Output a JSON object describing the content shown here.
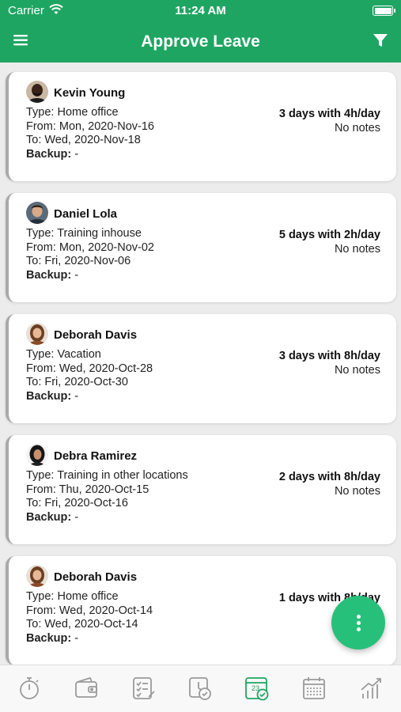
{
  "status_bar": {
    "carrier": "Carrier",
    "time": "11:24 AM"
  },
  "header": {
    "title": "Approve Leave",
    "menu_icon": "hamburger-menu-icon",
    "filter_icon": "filter-icon"
  },
  "leaves": [
    {
      "name": "Kevin Young",
      "type": "Type: Home office",
      "from": "From: Mon, 2020-Nov-16",
      "to": "To: Wed, 2020-Nov-18",
      "backup_label": "Backup:",
      "backup_value": " -",
      "duration": "3 days with 4h/day",
      "notes": "No notes"
    },
    {
      "name": "Daniel Lola",
      "type": "Type: Training inhouse",
      "from": "From: Mon, 2020-Nov-02",
      "to": "To: Fri, 2020-Nov-06",
      "backup_label": "Backup:",
      "backup_value": " -",
      "duration": "5 days with 2h/day",
      "notes": "No notes"
    },
    {
      "name": "Deborah Davis",
      "type": "Type: Vacation",
      "from": "From: Wed, 2020-Oct-28",
      "to": "To: Fri, 2020-Oct-30",
      "backup_label": "Backup:",
      "backup_value": " -",
      "duration": "3 days with 8h/day",
      "notes": "No notes"
    },
    {
      "name": "Debra Ramirez",
      "type": "Type: Training in other locations",
      "from": "From: Thu, 2020-Oct-15",
      "to": "To: Fri, 2020-Oct-16",
      "backup_label": "Backup:",
      "backup_value": " -",
      "duration": "2 days with 8h/day",
      "notes": "No notes"
    },
    {
      "name": "Deborah Davis",
      "type": "Type: Home office",
      "from": "From: Wed, 2020-Oct-14",
      "to": "To: Wed, 2020-Oct-14",
      "backup_label": "Backup:",
      "backup_value": " -",
      "duration": "1 days with 8h/day",
      "notes": ""
    }
  ],
  "tabbar": {
    "items": [
      "stopwatch-icon",
      "wallet-icon",
      "checklist-icon",
      "clock-check-icon",
      "calendar-check-icon",
      "calendar-grid-icon",
      "growth-chart-icon"
    ],
    "active_index": 4,
    "calendar_day": "23"
  },
  "colors": {
    "brand_green": "#1fa562",
    "fab_green": "#27c07a",
    "tab_inactive": "#9a9a9a"
  }
}
